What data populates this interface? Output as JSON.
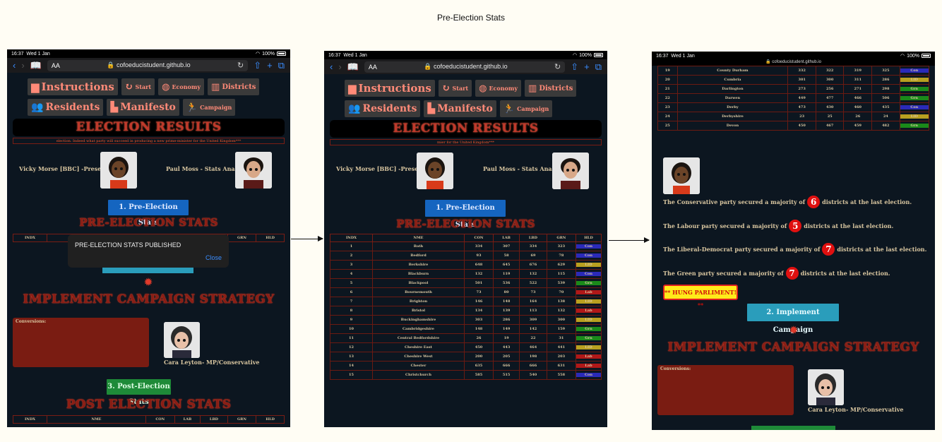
{
  "title": "Pre-Election Stats",
  "statusbar": {
    "time": "16:37",
    "date": "Wed 1 Jan",
    "battery": "100%"
  },
  "browser": {
    "text_size": "AA",
    "url": "cofoeducistudent.github.io",
    "url_lock": "🔒"
  },
  "nav": {
    "instructions": "Instructions",
    "start": "Start",
    "economy": "Economy",
    "districts": "Districts",
    "residents": "Residents",
    "manifesto": "Manifesto",
    "campaign": "Campaign"
  },
  "banner": "ELECTION RESULTS",
  "ticker_1": "election. Indeed what party will succeed in producing a new prime-minister for the United Kingdom***",
  "ticker_2": "mier for the United Kingdom***",
  "presenters": {
    "left": "Vicky Morse [BBC] -Presenter",
    "right": "Paul Moss - Stats Analyst"
  },
  "buttons": {
    "pre": "1. Pre-Election Stats",
    "implement": "2. Implement Campaign",
    "post": "3. Post-Election Stats"
  },
  "sections": {
    "pre": "PRE-ELECTION STATS",
    "strategy": "IMPLEMENT CAMPAIGN STRATEGY",
    "post": "POST ELECTION STATS"
  },
  "conversions_label": "Conversions:",
  "mp": "Cara Leyton- MP/Conservative",
  "toast": {
    "message": "PRE-ELECTION STATS PUBLISHED",
    "close": "Close"
  },
  "table_headers": [
    "INDX",
    "NME",
    "CON",
    "LAB",
    "LBD",
    "GRN",
    "HLD"
  ],
  "post_headers": [
    "INDX",
    "NME",
    "CON",
    "LAB",
    "LBD",
    "GRN",
    "HLD"
  ],
  "rows_mid": [
    [
      "1",
      "Bath",
      "334",
      "307",
      "334",
      "323",
      "Con"
    ],
    [
      "2",
      "Bedford",
      "93",
      "58",
      "69",
      "78",
      "Con"
    ],
    [
      "3",
      "Berkshire",
      "648",
      "645",
      "676",
      "629",
      "LID"
    ],
    [
      "4",
      "Blackburn",
      "132",
      "119",
      "132",
      "115",
      "Con"
    ],
    [
      "5",
      "Blackpool",
      "501",
      "536",
      "522",
      "539",
      "Grn"
    ],
    [
      "6",
      "Bournemouth",
      "73",
      "80",
      "73",
      "70",
      "Lab"
    ],
    [
      "7",
      "Brighton",
      "146",
      "148",
      "164",
      "138",
      "LID"
    ],
    [
      "8",
      "Bristol",
      "134",
      "139",
      "113",
      "132",
      "Lab"
    ],
    [
      "9",
      "Buckinghamshire",
      "303",
      "286",
      "309",
      "300",
      "LID"
    ],
    [
      "10",
      "Cambridgeshire",
      "148",
      "149",
      "142",
      "159",
      "Grn"
    ],
    [
      "11",
      "Central Bedfordshire",
      "26",
      "19",
      "22",
      "31",
      "Grn"
    ],
    [
      "12",
      "Cheshire East",
      "450",
      "443",
      "464",
      "441",
      "LID"
    ],
    [
      "13",
      "Cheshire West",
      "200",
      "205",
      "198",
      "203",
      "Lab"
    ],
    [
      "14",
      "Chester",
      "635",
      "666",
      "666",
      "631",
      "Lab"
    ],
    [
      "15",
      "Christchurch",
      "585",
      "515",
      "540",
      "558",
      "Con"
    ]
  ],
  "rows_right": [
    [
      "19",
      "County Durham",
      "332",
      "322",
      "319",
      "325",
      "Con"
    ],
    [
      "20",
      "Cumbria",
      "301",
      "300",
      "311",
      "286",
      "LID"
    ],
    [
      "21",
      "Darlington",
      "273",
      "256",
      "271",
      "298",
      "Grn"
    ],
    [
      "22",
      "Darwen",
      "449",
      "477",
      "466",
      "506",
      "Grn"
    ],
    [
      "23",
      "Derby",
      "473",
      "430",
      "460",
      "435",
      "Con"
    ],
    [
      "24",
      "Derbyshire",
      "23",
      "25",
      "26",
      "24",
      "LID"
    ],
    [
      "25",
      "Devon",
      "450",
      "467",
      "459",
      "482",
      "Grn"
    ]
  ],
  "majorities": [
    {
      "pre": "The Conservative party secured a majority of",
      "num": "6",
      "post": "districts at the last election."
    },
    {
      "pre": "The Labour party secured a majority of",
      "num": "5",
      "post": "districts at the last election."
    },
    {
      "pre": "The Liberal-Democrat party secured a majority of",
      "num": "7",
      "post": "districts at the last election."
    },
    {
      "pre": "The Green party secured a majority of",
      "num": "7",
      "post": "districts at the last election."
    }
  ],
  "hung": "** HUNG PARLIMENT! **",
  "colors": {
    "Con": "#2a2ab8",
    "Lab": "#b01818",
    "LID": "#b8a020",
    "Grn": "#1a8a1a"
  }
}
